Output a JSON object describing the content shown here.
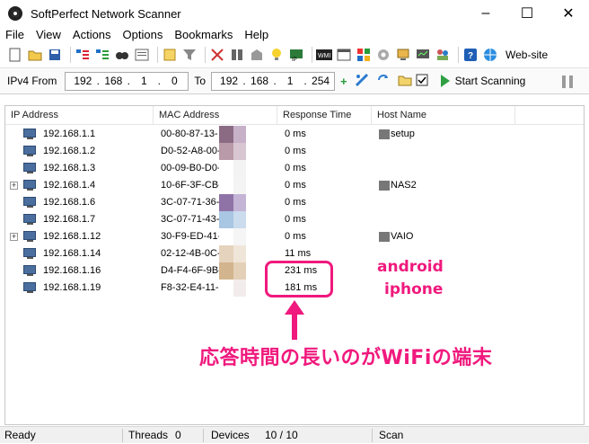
{
  "window": {
    "title": "SoftPerfect Network Scanner"
  },
  "menu": [
    "File",
    "View",
    "Actions",
    "Options",
    "Bookmarks",
    "Help"
  ],
  "toolbar": {
    "website_label": "Web-site"
  },
  "range": {
    "from_label": "IPv4 From",
    "from": [
      "192",
      "168",
      "1",
      "0"
    ],
    "to_label": "To",
    "to": [
      "192",
      "168",
      "1",
      "254"
    ],
    "start_label": "Start Scanning"
  },
  "columns": [
    "IP Address",
    "MAC Address",
    "Response Time",
    "Host Name"
  ],
  "rows": [
    {
      "ip": "192.168.1.1",
      "mac": "00-80-87-13-",
      "resp": "0 ms",
      "host": "setup",
      "expand": false
    },
    {
      "ip": "192.168.1.2",
      "mac": "D0-52-A8-00-",
      "resp": "0 ms",
      "host": "",
      "expand": false
    },
    {
      "ip": "192.168.1.3",
      "mac": "00-09-B0-D0-",
      "resp": "0 ms",
      "host": "",
      "expand": false
    },
    {
      "ip": "192.168.1.4",
      "mac": "10-6F-3F-CB-",
      "resp": "0 ms",
      "host": "NAS2",
      "expand": true
    },
    {
      "ip": "192.168.1.6",
      "mac": "3C-07-71-36-",
      "resp": "0 ms",
      "host": "",
      "expand": false
    },
    {
      "ip": "192.168.1.7",
      "mac": "3C-07-71-43-",
      "resp": "0 ms",
      "host": "",
      "expand": false
    },
    {
      "ip": "192.168.1.12",
      "mac": "30-F9-ED-41-",
      "resp": "0 ms",
      "host": "VAIO",
      "expand": true
    },
    {
      "ip": "192.168.1.14",
      "mac": "02-12-4B-0C-",
      "resp": "11 ms",
      "host": "",
      "expand": false
    },
    {
      "ip": "192.168.1.16",
      "mac": "D4-F4-6F-9B-",
      "resp": "231 ms",
      "host": "",
      "expand": false
    },
    {
      "ip": "192.168.1.19",
      "mac": "F8-32-E4-11-",
      "resp": "181 ms",
      "host": "",
      "expand": false
    }
  ],
  "annotations": {
    "android": "android",
    "iphone": "iphone",
    "note": "応答時間の長いのがWiFiの端末"
  },
  "status": {
    "ready": "Ready",
    "threads_label": "Threads",
    "threads": "0",
    "devices_label": "Devices",
    "devices": "10 / 10",
    "scan": "Scan"
  },
  "colors": {
    "accent": "#f0197d"
  }
}
